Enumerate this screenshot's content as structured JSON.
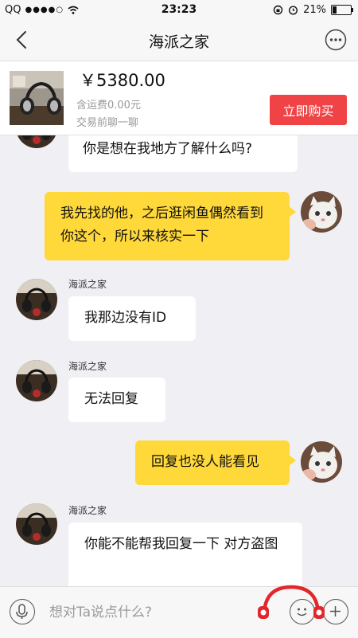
{
  "status_bar": {
    "carrier": "QQ",
    "signal": "●●●●○",
    "time": "23:23",
    "battery_pct": "21%",
    "battery_level": 0.21
  },
  "nav": {
    "title": "海派之家"
  },
  "product": {
    "price": "￥5380.00",
    "shipping": "含运费0.00元",
    "trade_note": "交易前聊一聊",
    "buy_label": "立即购买"
  },
  "messages": [
    {
      "side": "in",
      "text": "你是想在我地方了解什么吗?"
    },
    {
      "side": "out",
      "text": "我先找的他，之后逛闲鱼偶然看到你这个，所以来核实一下"
    },
    {
      "side": "in",
      "sender": "海派之家",
      "text": "我那边没有ID"
    },
    {
      "side": "in",
      "sender": "海派之家",
      "text": "无法回复"
    },
    {
      "side": "out",
      "text": "回复也没人能看见"
    },
    {
      "side": "in",
      "sender": "海派之家",
      "text": "你能不能帮我回复一下 对方盗图"
    }
  ],
  "input": {
    "placeholder": "想对Ta说点什么?"
  },
  "icons": {
    "back": "chevron-left-icon",
    "more": "more-dots-icon",
    "voice": "microphone-icon",
    "emoji": "smiley-icon",
    "plus": "plus-icon"
  },
  "colors": {
    "buy_button": "#f04346",
    "outgoing_bubble": "#ffd83a",
    "incoming_bubble": "#ffffff",
    "background": "#efeff4"
  }
}
